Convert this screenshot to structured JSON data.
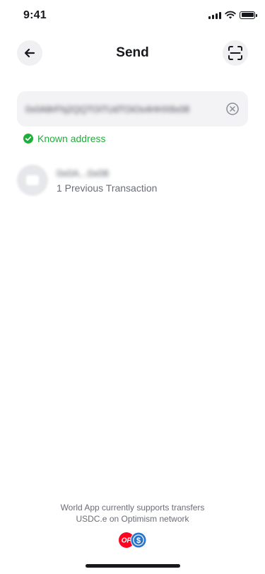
{
  "status_bar": {
    "time": "9:41",
    "icons": [
      "cellular-signal-icon",
      "wifi-icon",
      "battery-icon"
    ]
  },
  "header": {
    "title": "Send",
    "back_icon": "arrow-left-icon",
    "scan_icon": "qr-scan-icon"
  },
  "address_field": {
    "value": "0x0A8rFhj2QQTOiTUdTOiOs4HHX8x08",
    "clear_icon": "clear-circle-icon"
  },
  "known_address": {
    "label": "Known address",
    "icon": "check-circle-icon",
    "color": "#1fae3a"
  },
  "recent": {
    "items": [
      {
        "name": "0x0A...0x08",
        "subtitle": "1 Previous Transaction",
        "icon": "wallet-icon"
      }
    ]
  },
  "footer": {
    "line1": "World App currently supports transfers",
    "line2": "USDC.e on Optimism network",
    "network_icon": "optimism-icon",
    "network_label": "OP",
    "token_icon": "usdc-icon",
    "token_symbol": "$",
    "colors": {
      "optimism": "#ff0420",
      "usdc": "#2775ca"
    }
  }
}
